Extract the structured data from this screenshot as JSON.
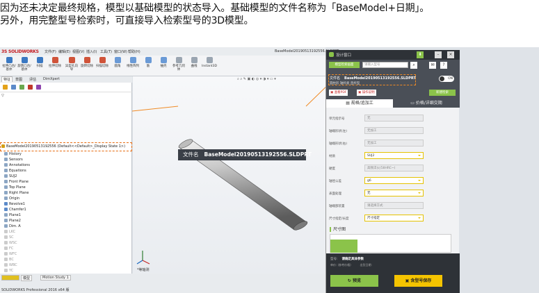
{
  "instruction": {
    "line1": "因为还未决定最终规格，模型以基础模型的状态导入。基础模型的文件名称为「BaseModel+日期」。",
    "line2": "另外，用完整型号检索时，可直接导入检索型号的3D模型。"
  },
  "solidworks": {
    "logo": "3S SOLIDWORKS",
    "menus": [
      "文件(F)",
      "编辑(E)",
      "视图(V)",
      "插入(I)",
      "工具(T)",
      "窗口(W)",
      "帮助(H)"
    ],
    "window_title": "BaseModel20190513192556.SLDPRT",
    "ribbon": [
      "拉伸凸台/基体",
      "旋转凸台/基体",
      "扫描",
      "放样凸台/基体",
      "边界凸台/基体",
      "拉伸切除",
      "异型孔向导",
      "旋转切除",
      "扫描切除",
      "放样切割",
      "边界切除",
      "圆角",
      "线性阵列",
      "筋",
      "拔模",
      "抽壳",
      "包覆",
      "相交",
      "镜向",
      "参考几何体",
      "曲线",
      "Instant3D"
    ],
    "tabs": [
      "特征",
      "草图",
      "评估",
      "DimXpert"
    ],
    "tree_root": "BaseModel20190513192556 (Default<<Default>_Display State 1>)",
    "tree_items": [
      "History",
      "Sensors",
      "Annotations",
      "Equations",
      "SUJ2",
      "Front Plane",
      "Top Plane",
      "Right Plane",
      "Origin",
      "Revolve1",
      "Chamfer1",
      "Plane1",
      "Plane2",
      "Dim. A",
      "LKC",
      "SC",
      "WSC",
      "FC",
      "WFC",
      "BC",
      "WBC",
      "YC",
      "WYC",
      "SC",
      "WKC"
    ],
    "bottom_tabs": [
      "模型",
      "Motion Study 1"
    ],
    "status": "SOLIDWORKS Professional 2016 x64 版",
    "view_label": "*等轴测"
  },
  "callout": {
    "label": "文件名",
    "value": "BaseModel20190513192556.SLDPRT"
  },
  "panel": {
    "title": "设计窗口",
    "mode_button": "模型检索画面",
    "search_placeholder": "请输入型号",
    "filename_label": "文件名",
    "filename_value": "BaseModel20190513192556.SLDPRT",
    "sub_info": "圆柱形 轴杆类 直杆型",
    "toggle": "ON",
    "pdf_button": "查看PDF",
    "manual_button": "操作说明",
    "new_button": "新建检索",
    "tab_spec": "规格/追加工",
    "tab_price": "价格/详细交期",
    "fields": [
      {
        "label": "单元指示号",
        "value": "无",
        "selected": false
      },
      {
        "label": "轴端形状(左)",
        "value": "无加工",
        "selected": false
      },
      {
        "label": "轴端形状(右)",
        "value": "无加工",
        "selected": false
      },
      {
        "label": "材质",
        "value": "SUJ2",
        "selected": true
      },
      {
        "label": "硬度",
        "value": "高频淬火(58HRC~)",
        "selected": false
      },
      {
        "label": "轴径公差",
        "value": "g6",
        "selected": true
      },
      {
        "label": "表面处理",
        "value": "无",
        "selected": true
      },
      {
        "label": "轴端部装置",
        "value": "请选择方式",
        "selected": false
      },
      {
        "label": "尺寸指定/长度",
        "value": "尺寸指定",
        "selected": true
      }
    ],
    "dimension_header": "尺寸图",
    "footer_model_label": "型号:",
    "footer_model_value": "请确定具体参数",
    "footer_price_label": "单价: (参考价格)",
    "footer_ship_label": "出货日期:",
    "btn_search": "预览",
    "btn_save": "含型号保存"
  }
}
